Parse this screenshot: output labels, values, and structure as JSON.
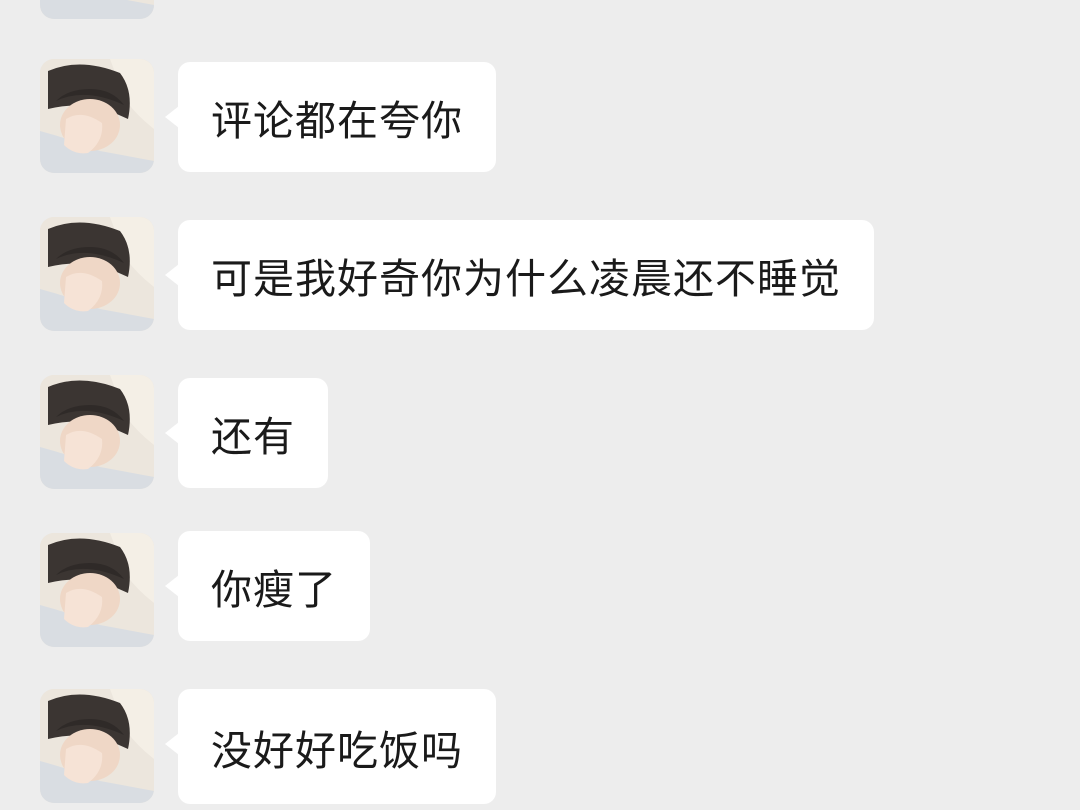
{
  "chat": {
    "messages": [
      {
        "text": ""
      },
      {
        "text": "评论都在夸你"
      },
      {
        "text": "可是我好奇你为什么凌晨还不睡觉"
      },
      {
        "text": "还有"
      },
      {
        "text": "你瘦了"
      },
      {
        "text": "没好好吃饭吗"
      }
    ]
  },
  "colors": {
    "background": "#ededed",
    "bubble": "#ffffff",
    "text": "#1a1a1a"
  },
  "icons": {
    "avatar": "profile-photo-icon"
  }
}
